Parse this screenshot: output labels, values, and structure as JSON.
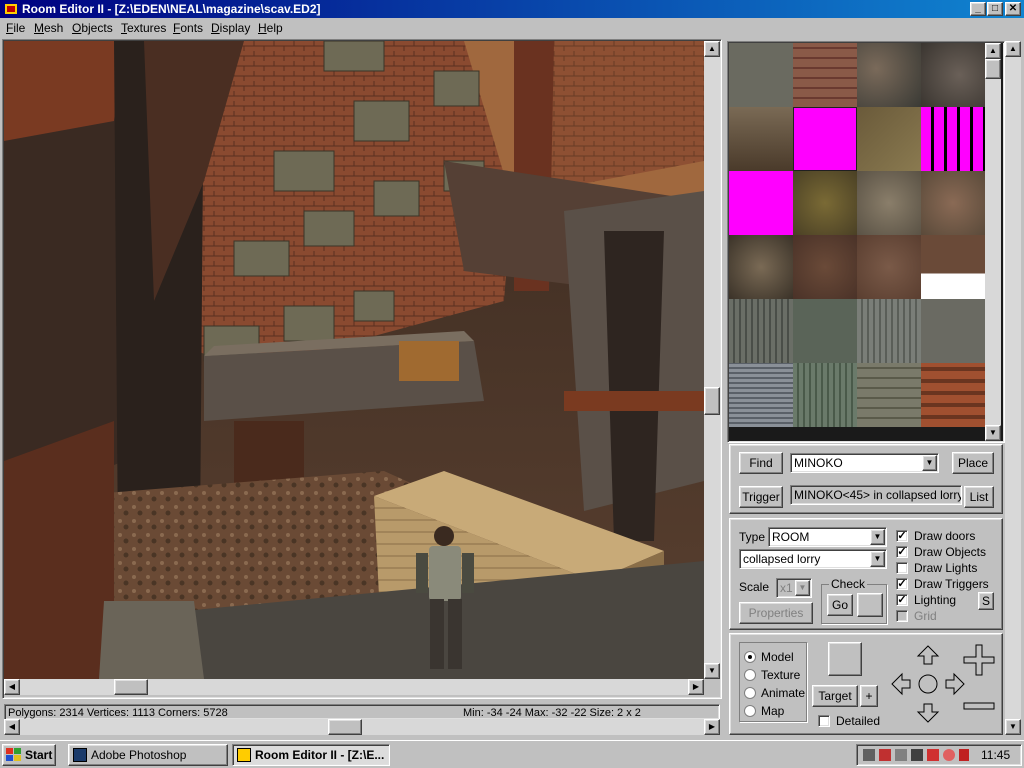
{
  "window": {
    "title": "Room Editor II - [Z:\\EDEN\\NEAL\\magazine\\scav.ED2]",
    "buttons": {
      "minimize": "_",
      "maximize": "□",
      "close": "✕"
    }
  },
  "menu": [
    "File",
    "Mesh",
    "Objects",
    "Textures",
    "Fonts",
    "Display",
    "Help"
  ],
  "status": {
    "counts": "Polygons: 2314  Vertices: 1113  Corners: 5728",
    "bounds": "Min: -34 -24  Max: -32 -22  Size: 2 x 2"
  },
  "find": {
    "find_label": "Find",
    "find_value": "MINOKO",
    "place_label": "Place",
    "trigger_label": "Trigger",
    "trigger_value": "MINOKO<45> in collapsed lorry",
    "list_label": "List"
  },
  "props": {
    "type_label": "Type",
    "type_value": "ROOM",
    "object_value": "collapsed lorry",
    "scale_label": "Scale",
    "scale_value": "x1",
    "check_label": "Check",
    "go_label": "Go",
    "properties_label": "Properties",
    "checkboxes": [
      {
        "label": "Draw doors",
        "checked": true
      },
      {
        "label": "Draw Objects",
        "checked": true
      },
      {
        "label": "Draw Lights",
        "checked": false
      },
      {
        "label": "Draw Triggers",
        "checked": true
      },
      {
        "label": "Lighting",
        "checked": true
      },
      {
        "label": "Grid",
        "checked": false,
        "disabled": true
      }
    ],
    "s_label": "S"
  },
  "mode": {
    "options": [
      "Model",
      "Texture",
      "Animate",
      "Map"
    ],
    "selected": "Model",
    "target_label": "Target",
    "plus_label": "+",
    "detailed_label": "Detailed"
  },
  "taskbar": {
    "start_label": "Start",
    "tasks": [
      "Adobe Photoshop",
      "Room Editor II - [Z:\\E..."
    ],
    "clock": "11:45"
  },
  "colors": {
    "title_bar": "#000080",
    "window_face": "#c0c0c0",
    "magenta_texture": "#ff00ff"
  }
}
